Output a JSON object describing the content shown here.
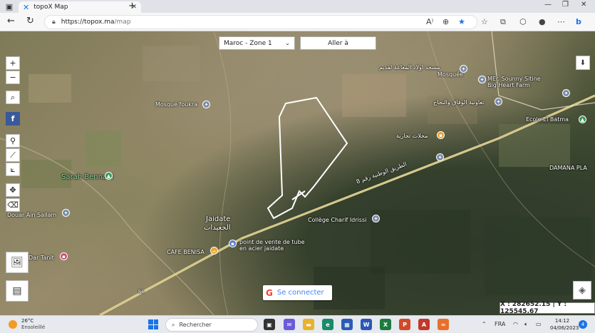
{
  "browser": {
    "tab_title": "topoX Map",
    "url_host": "https://topox.ma",
    "url_path": "/map"
  },
  "map": {
    "zone_select": "Maroc - Zone 1",
    "goto_button": "Aller à",
    "zoom_in": "+",
    "zoom_out": "−",
    "google_button": "Se connecter",
    "coords": "X : 282652.15 | Y : 125545.67",
    "labels": {
      "mosque_foukra": "Mosqué foukra",
      "sarah_bennani": "Sarah Bennani",
      "douar_ain_sallam": "Douar Ain Sallam",
      "dar_tanit": "Dar Tanit",
      "jaidate": "Jaidate",
      "jaidate_ar": "الجعيدات",
      "cafe_benisa": "CAFE BENISA",
      "tube_shop": "point de vente de tube en acier jaidate",
      "college": "Collège Charif Idrissi",
      "mosquee_ar": "مسجد اولاد المعاعة لقديم",
      "mosquee": "Mosquée",
      "mer_sounny": "MEr. Sounny Sitine Big Heart Farm",
      "taawonia_ar": "تعاونية الوفاق والنجاح",
      "ecole": "Ecole El Batma",
      "shops_ar": "محلات تجارية",
      "damana": "DAMANA PLA",
      "road_ar": "الطريق الوطنية رقم 8",
      "road_num": "R6"
    }
  },
  "taskbar": {
    "temp": "26°C",
    "weather": "Ensoleillé",
    "search_placeholder": "Rechercher",
    "lang": "FRA",
    "time": "14:12",
    "date": "04/06/2023",
    "notif_count": "4"
  }
}
